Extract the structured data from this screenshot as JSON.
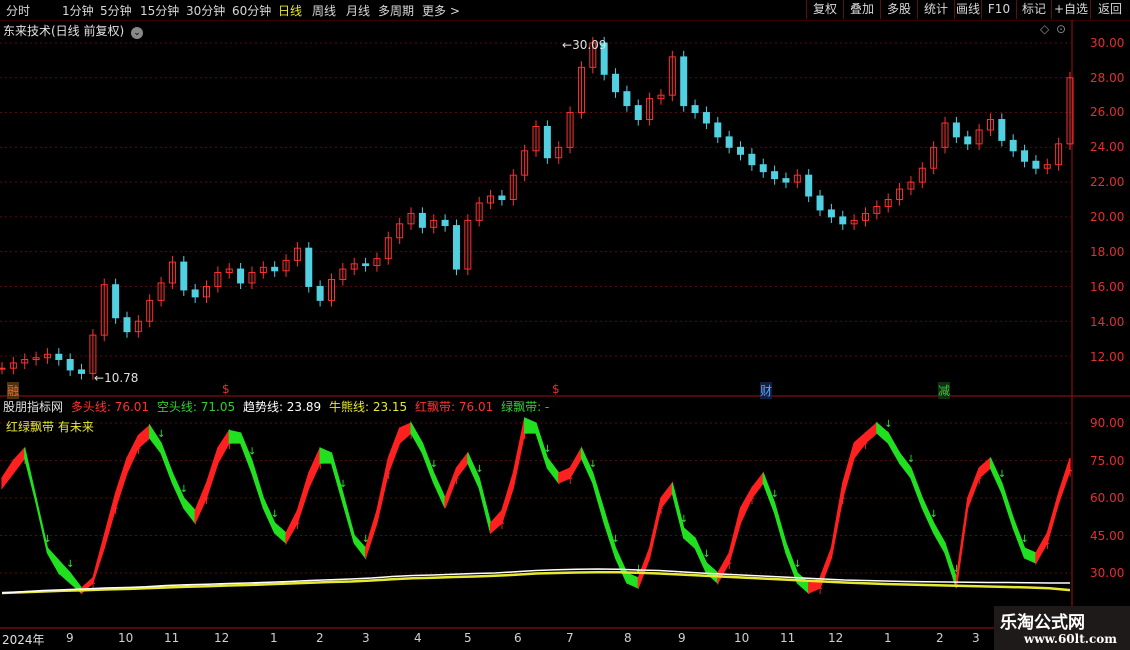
{
  "toolbar": {
    "periods": [
      "分时",
      "1分钟",
      "5分钟",
      "15分钟",
      "30分钟",
      "60分钟",
      "日线",
      "周线",
      "月线",
      "多周期",
      "更多 >"
    ],
    "active_period": "日线",
    "buttons": [
      "复权",
      "叠加",
      "多股",
      "统计",
      "画线",
      "F10",
      "标记",
      "+自选",
      "返回"
    ]
  },
  "chart_title": "东来技术(日线 前复权)",
  "price_axis": [
    "30.00",
    "28.00",
    "26.00",
    "24.00",
    "22.00",
    "20.00",
    "18.00",
    "16.00",
    "14.00",
    "12.00"
  ],
  "price_annotations": {
    "high": "30.09",
    "low": "10.78"
  },
  "markers": [
    {
      "text": "融",
      "color": "#e07030"
    },
    {
      "text": "$",
      "color": "#e03030"
    },
    {
      "text": "$",
      "color": "#e03030"
    },
    {
      "text": "财",
      "color": "#60a0ff"
    },
    {
      "text": "减",
      "color": "#40c040"
    }
  ],
  "indicator": {
    "name": "股朋指标网",
    "lines": [
      {
        "label": "多头线: 76.01",
        "color": "#ff3030"
      },
      {
        "label": "空头线: 71.05",
        "color": "#30d030"
      },
      {
        "label": "趋势线: 23.89",
        "color": "#ffffff"
      },
      {
        "label": "牛熊线: 23.15",
        "color": "#e8e830"
      },
      {
        "label": "红飘带: 76.01",
        "color": "#ff3030"
      },
      {
        "label": "绿飘带: -",
        "color": "#30d030"
      }
    ],
    "subtitle": "红绿飘带 有未来",
    "axis": [
      "90.00",
      "75.00",
      "60.00",
      "45.00",
      "30.00"
    ]
  },
  "dates": [
    "2024年",
    "9",
    "10",
    "11",
    "12",
    "1",
    "2",
    "3",
    "4",
    "5",
    "6",
    "7",
    "8",
    "9",
    "10",
    "11",
    "12",
    "1",
    "2",
    "3"
  ],
  "watermark": {
    "line1": "乐淘公式网",
    "line2": "www.60lt.com"
  },
  "chart_data": {
    "type": "line",
    "title": "东来技术(日线 前复权)",
    "price_range": [
      10.78,
      30.09
    ],
    "price_series": [
      11.3,
      11.6,
      11.8,
      11.9,
      12.1,
      11.8,
      11.2,
      11.0,
      13.2,
      16.1,
      14.2,
      13.4,
      14.0,
      15.2,
      16.2,
      17.4,
      15.8,
      15.4,
      16.0,
      16.8,
      17.0,
      16.2,
      16.8,
      17.1,
      16.9,
      17.5,
      18.2,
      16.0,
      15.2,
      16.4,
      17.0,
      17.3,
      17.2,
      17.6,
      18.8,
      19.6,
      20.2,
      19.4,
      19.8,
      19.5,
      17.0,
      19.8,
      20.8,
      21.2,
      21.0,
      22.4,
      23.8,
      25.2,
      23.4,
      24.0,
      26.0,
      28.6,
      30.0,
      28.2,
      27.2,
      26.4,
      25.6,
      26.8,
      27.0,
      29.2,
      26.4,
      26.0,
      25.4,
      24.6,
      24.0,
      23.6,
      23.0,
      22.6,
      22.2,
      22.0,
      22.4,
      21.2,
      20.4,
      20.0,
      19.6,
      19.8,
      20.2,
      20.6,
      21.0,
      21.6,
      22.0,
      22.8,
      24.0,
      25.4,
      24.6,
      24.2,
      25.0,
      25.6,
      24.4,
      23.8,
      23.2,
      22.8,
      23.0,
      24.2,
      28.0
    ],
    "oscillator_range": [
      20,
      95
    ],
    "long_series": [
      68,
      75,
      80,
      60,
      40,
      35,
      30,
      24,
      28,
      45,
      62,
      76,
      85,
      89,
      82,
      70,
      60,
      55,
      66,
      80,
      87,
      86,
      75,
      60,
      50,
      46,
      55,
      70,
      80,
      78,
      62,
      45,
      40,
      55,
      76,
      88,
      90,
      82,
      70,
      60,
      72,
      78,
      68,
      50,
      55,
      70,
      92,
      90,
      76,
      70,
      72,
      80,
      70,
      55,
      40,
      30,
      28,
      40,
      60,
      66,
      48,
      44,
      34,
      30,
      38,
      56,
      64,
      70,
      58,
      42,
      30,
      26,
      28,
      40,
      66,
      82,
      86,
      90,
      86,
      78,
      72,
      60,
      50,
      42,
      28,
      60,
      72,
      76,
      66,
      52,
      40,
      38,
      46,
      62,
      76
    ],
    "short_series": [
      64,
      70,
      76,
      58,
      38,
      30,
      26,
      22,
      26,
      40,
      56,
      70,
      80,
      84,
      78,
      66,
      56,
      50,
      60,
      74,
      82,
      82,
      70,
      56,
      46,
      42,
      50,
      64,
      74,
      74,
      58,
      42,
      36,
      50,
      70,
      82,
      86,
      78,
      66,
      56,
      68,
      74,
      64,
      46,
      50,
      64,
      86,
      86,
      72,
      66,
      68,
      76,
      66,
      50,
      36,
      26,
      24,
      36,
      56,
      62,
      44,
      40,
      30,
      26,
      34,
      50,
      60,
      66,
      54,
      38,
      26,
      22,
      24,
      36,
      60,
      76,
      82,
      86,
      82,
      74,
      68,
      56,
      46,
      38,
      24,
      56,
      68,
      72,
      62,
      48,
      36,
      34,
      42,
      58,
      71
    ],
    "trend_series": [
      22,
      22.5,
      23,
      23.3,
      23.6,
      24,
      24.2,
      24.5,
      25,
      25.3,
      25.5,
      25.8,
      26,
      26.3,
      26.6,
      27,
      27.3,
      27.6,
      28,
      28.6,
      29,
      29.2,
      29.5,
      29.8,
      30,
      30.5,
      31,
      31.3,
      31.5,
      31.6,
      31.5,
      31.2,
      31,
      30.5,
      30,
      29.6,
      29.2,
      28.8,
      28.4,
      28,
      27.6,
      27.2,
      27,
      26.8,
      26.6,
      26.5,
      26.4,
      26.3,
      26.2,
      26.2,
      26.1,
      26,
      26
    ],
    "bull_bear_series": [
      22,
      22.3,
      22.6,
      22.9,
      23.1,
      23.4,
      23.6,
      23.9,
      24.2,
      24.5,
      24.7,
      25,
      25.2,
      25.5,
      25.8,
      26.1,
      26.4,
      26.6,
      27,
      27.5,
      27.9,
      28.1,
      28.4,
      28.6,
      28.9,
      29.3,
      29.8,
      30,
      30.2,
      30.3,
      30.3,
      30.1,
      29.8,
      29.4,
      29,
      28.6,
      28.2,
      27.8,
      27.4,
      27,
      26.6,
      26.2,
      25.9,
      25.6,
      25.4,
      25.2,
      25,
      24.8,
      24.6,
      24.4,
      24.2,
      23.9,
      23.15
    ]
  }
}
